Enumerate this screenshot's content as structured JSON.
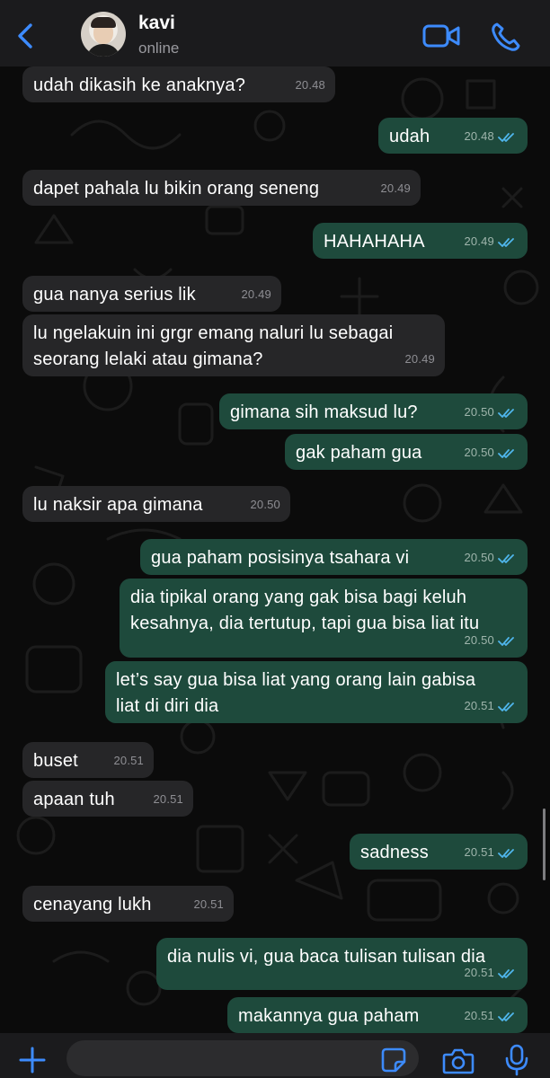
{
  "header": {
    "contact_name": "kavi",
    "contact_status": "online"
  },
  "colors": {
    "accent": "#3d8bfd",
    "incoming_bubble": "#262628",
    "outgoing_bubble": "#1e4a3c",
    "read_tick": "#4fb6ec"
  },
  "messages": [
    {
      "dir": "in",
      "text": "udah dikasih ke anaknya?",
      "time": "20.48"
    },
    {
      "dir": "out",
      "text": "udah",
      "time": "20.48",
      "read": true
    },
    {
      "dir": "in",
      "text": "dapet pahala lu bikin orang seneng",
      "time": "20.49"
    },
    {
      "dir": "out",
      "text": "HAHAHAHA",
      "time": "20.49",
      "read": true
    },
    {
      "dir": "in",
      "text": "gua nanya serius lik",
      "time": "20.49"
    },
    {
      "dir": "in",
      "lines": [
        "lu ngelakuin ini grgr emang naluri lu sebagai",
        "seorang lelaki atau gimana?"
      ],
      "time": "20.49"
    },
    {
      "dir": "out",
      "text": "gimana sih maksud lu?",
      "time": "20.50",
      "read": true
    },
    {
      "dir": "out",
      "text": "gak paham gua",
      "time": "20.50",
      "read": true
    },
    {
      "dir": "in",
      "text": "lu naksir apa gimana",
      "time": "20.50"
    },
    {
      "dir": "out",
      "text": "gua paham posisinya tsahara vi",
      "time": "20.50",
      "read": true
    },
    {
      "dir": "out",
      "lines": [
        "dia tipikal orang yang gak bisa bagi keluh",
        "kesahnya, dia tertutup, tapi gua bisa liat itu"
      ],
      "time": "20.50",
      "read": true
    },
    {
      "dir": "out",
      "lines": [
        "let’s say gua bisa liat yang orang lain gabisa",
        "liat di diri dia"
      ],
      "time": "20.51",
      "read": true
    },
    {
      "dir": "in",
      "text": "buset",
      "time": "20.51"
    },
    {
      "dir": "in",
      "text": "apaan tuh",
      "time": "20.51"
    },
    {
      "dir": "out",
      "text": "sadness",
      "time": "20.51",
      "read": true
    },
    {
      "dir": "in",
      "text": "cenayang lukh",
      "time": "20.51"
    },
    {
      "dir": "out",
      "text": "dia nulis vi, gua baca tulisan tulisan dia",
      "time": "20.51",
      "read": true
    },
    {
      "dir": "out",
      "text": "makannya gua paham",
      "time": "20.51",
      "read": true
    }
  ],
  "composer": {
    "value": ""
  }
}
